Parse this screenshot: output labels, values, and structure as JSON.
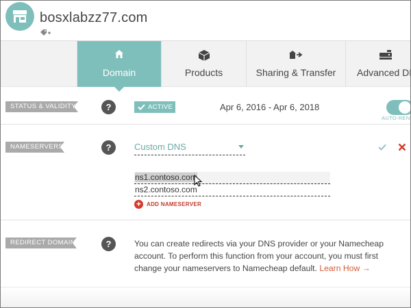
{
  "header": {
    "domain_title": "bosxlabzz77.com",
    "store_icon": "store-icon",
    "tag_icon": "tag-add-icon"
  },
  "tabs": [
    {
      "label": "Domain",
      "icon": "home-icon",
      "active": true
    },
    {
      "label": "Products",
      "icon": "box-icon",
      "active": false
    },
    {
      "label": "Sharing & Transfer",
      "icon": "share-transfer-icon",
      "active": false
    },
    {
      "label": "Advanced DNS",
      "icon": "server-icon",
      "active": false
    }
  ],
  "status": {
    "label": "STATUS & VALIDITY",
    "badge": "ACTIVE",
    "date_range": "Apr 6, 2016 - Apr 6, 2018",
    "auto_renew_label": "AUTO-RENEW",
    "auto_renew_on": true
  },
  "nameservers": {
    "label": "NAMESERVERS",
    "selected_option": "Custom DNS",
    "entries": [
      "ns1.contoso.com",
      "ns2.contoso.com"
    ],
    "add_label": "ADD NAMESERVER"
  },
  "redirect": {
    "label": "REDIRECT DOMAIN",
    "text": "You can create redirects via your DNS provider or your Namecheap account. To perform this function from your account, you must first change your nameservers to Namecheap default.",
    "link": "Learn How →"
  },
  "help_glyph": "?",
  "colors": {
    "accent": "#7fbfbb",
    "ribbon": "#aaaaaa",
    "danger": "#d63a2c",
    "link": "#d35a38"
  }
}
